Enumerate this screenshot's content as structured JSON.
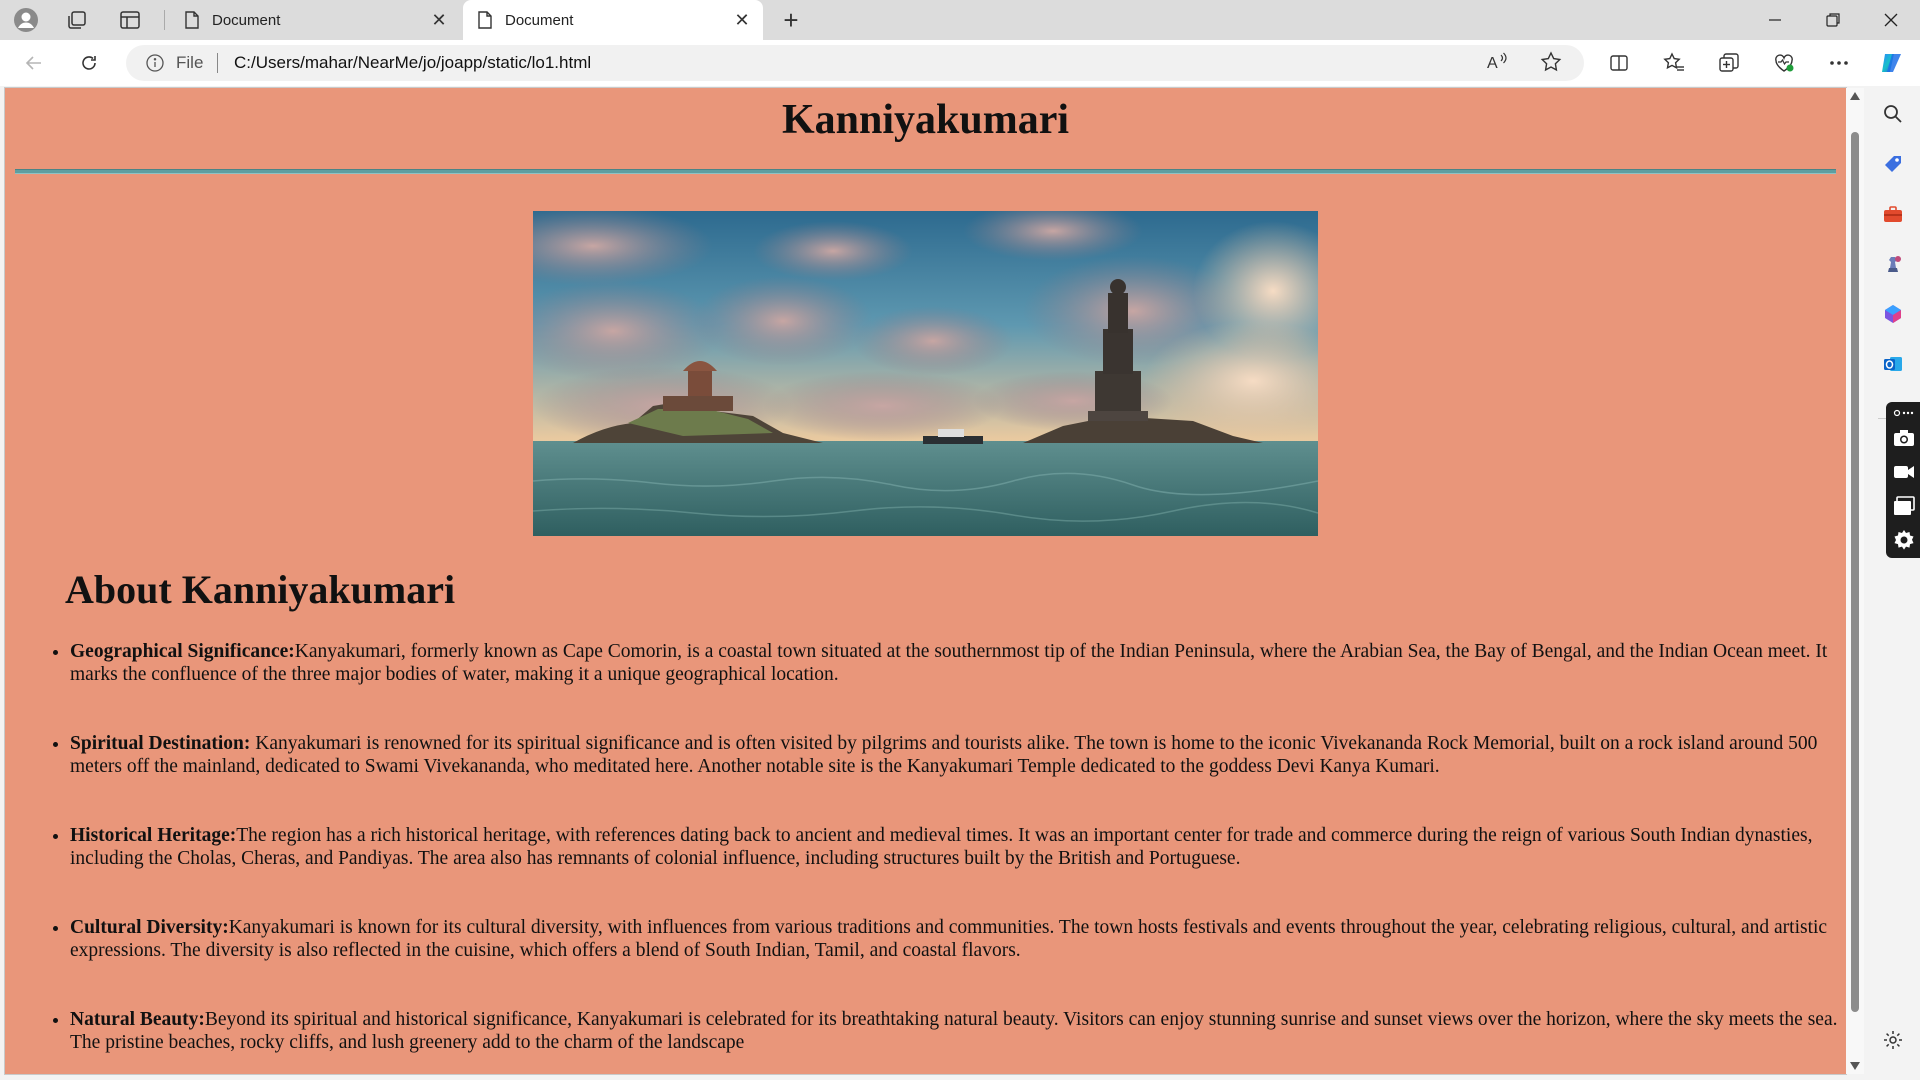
{
  "browser": {
    "tabs": [
      {
        "title": "Document",
        "active": false
      },
      {
        "title": "Document",
        "active": true
      }
    ],
    "address": {
      "scheme_label": "File",
      "url": "C:/Users/mahar/NearMe/jo/joapp/static/lo1.html"
    },
    "colors": {
      "tabstrip": "#dcdcdc",
      "toolbar": "#ffffff",
      "accent": "#0078d4"
    }
  },
  "page": {
    "background": "#e9967a",
    "title": "Kanniyakumari",
    "hr_color": "#5f9ea0",
    "about_heading": "About Kanniyakumari",
    "facts": [
      {
        "label": "Geographical Significance:",
        "text": "Kanyakumari, formerly known as Cape Comorin, is a coastal town situated at the southernmost tip of the Indian Peninsula, where the Arabian Sea, the Bay of Bengal, and the Indian Ocean meet. It marks the confluence of the three major bodies of water, making it a unique geographical location."
      },
      {
        "label": "Spiritual Destination:",
        "text": " Kanyakumari is renowned for its spiritual significance and is often visited by pilgrims and tourists alike. The town is home to the iconic Vivekananda Rock Memorial, built on a rock island around 500 meters off the mainland, dedicated to Swami Vivekananda, who meditated here. Another notable site is the Kanyakumari Temple dedicated to the goddess Devi Kanya Kumari."
      },
      {
        "label": "Historical Heritage:",
        "text": "The region has a rich historical heritage, with references dating back to ancient and medieval times. It was an important center for trade and commerce during the reign of various South Indian dynasties, including the Cholas, Cheras, and Pandiyas. The area also has remnants of colonial influence, including structures built by the British and Portuguese."
      },
      {
        "label": "Cultural Diversity:",
        "text": "Kanyakumari is known for its cultural diversity, with influences from various traditions and communities. The town hosts festivals and events throughout the year, celebrating religious, cultural, and artistic expressions. The diversity is also reflected in the cuisine, which offers a blend of South Indian, Tamil, and coastal flavors."
      },
      {
        "label": "Natural Beauty:",
        "text": "Beyond its spiritual and historical significance, Kanyakumari is celebrated for its breathtaking natural beauty. Visitors can enjoy stunning sunrise and sunset views over the horizon, where the sky meets the sea. The pristine beaches, rocky cliffs, and lush greenery add to the charm of the landscape"
      }
    ]
  }
}
